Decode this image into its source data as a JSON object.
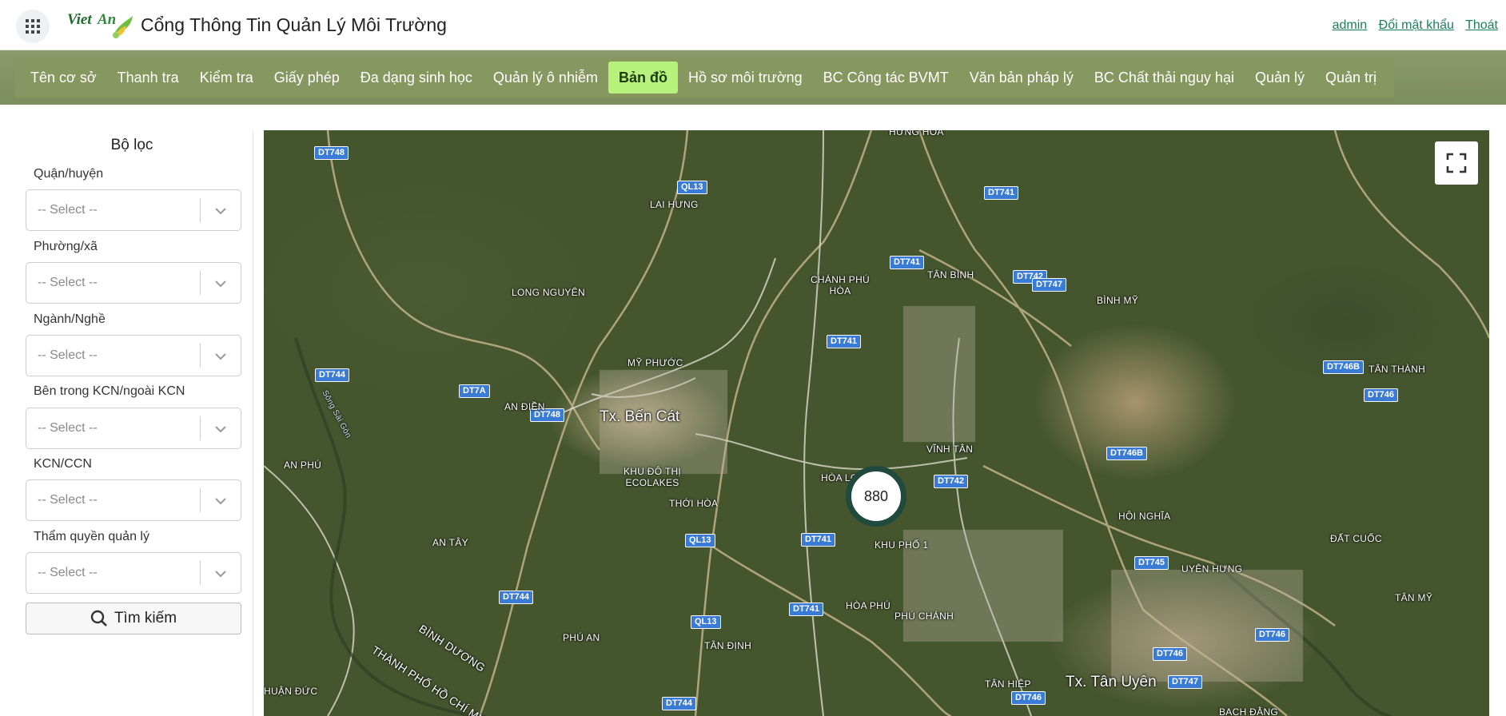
{
  "header": {
    "title": "Cổng Thông Tin Quản Lý Môi Trường",
    "logo_text": "Viet An",
    "links": [
      "admin",
      "Đổi mật khẩu",
      "Thoát"
    ]
  },
  "nav": {
    "items": [
      "Tên cơ sở",
      "Thanh tra",
      "Kiểm tra",
      "Giấy phép",
      "Đa dạng sinh học",
      "Quản lý ô nhiễm",
      "Bản đồ",
      "Hồ sơ môi trường",
      "BC Công tác BVMT",
      "Văn bản pháp lý",
      "BC Chất thải nguy hại",
      "Quản lý",
      "Quản trị"
    ],
    "active": "Bản đồ",
    "colors": {
      "bar": "#86975f",
      "active_bg": "#b6f27c"
    }
  },
  "filter": {
    "title": "Bộ lọc",
    "fields": [
      {
        "label": "Quận/huyện",
        "value": "-- Select --"
      },
      {
        "label": "Phường/xã",
        "value": "-- Select --"
      },
      {
        "label": "Ngành/Nghề",
        "value": "-- Select --"
      },
      {
        "label": "Bên trong KCN/ngoài KCN",
        "value": "-- Select --"
      },
      {
        "label": "KCN/CCN",
        "value": "-- Select --"
      },
      {
        "label": "Thẩm quyền quản lý",
        "value": "-- Select --"
      }
    ],
    "search_label": "Tìm kiếm"
  },
  "map": {
    "cluster_count": "880",
    "places": [
      "HƯNG HÒA",
      "LAI HƯNG",
      "LONG NGUYÊN",
      "CHÁNH PHÚ HÒA",
      "TÂN BÌNH",
      "BÌNH MỸ",
      "MỸ PHƯỚC",
      "AN ĐIỀN",
      "Tx. Bến Cát",
      "KHU ĐÔ THỊ ECOLAKES",
      "VĨNH TÂN",
      "TÂN THÀNH",
      "AN PHÚ",
      "HÒA LỢI",
      "THỚI HÒA",
      "HỘI NGHĨA",
      "ĐẤT CUỐC",
      "AN TÂY",
      "KHU PHỐ 1",
      "UYÊN HƯNG",
      "TÂN MỸ",
      "HÒA PHÚ",
      "PHÚ CHÁNH",
      "PHÚ AN",
      "TÂN ĐỊNH",
      "BÌNH DƯƠNG",
      "THÀNH PHỐ HỒ CHÍ MINH",
      "HUẬN ĐỨC",
      "TÂN HIỆP",
      "Tx. Tân Uyên",
      "BẠCH ĐẰNG",
      "Sông Sài Gòn"
    ],
    "roads": [
      "DT748",
      "QL13",
      "DT741",
      "DT742",
      "DT747",
      "DT744",
      "DT7A",
      "DT746B",
      "DT746",
      "DT745"
    ]
  }
}
